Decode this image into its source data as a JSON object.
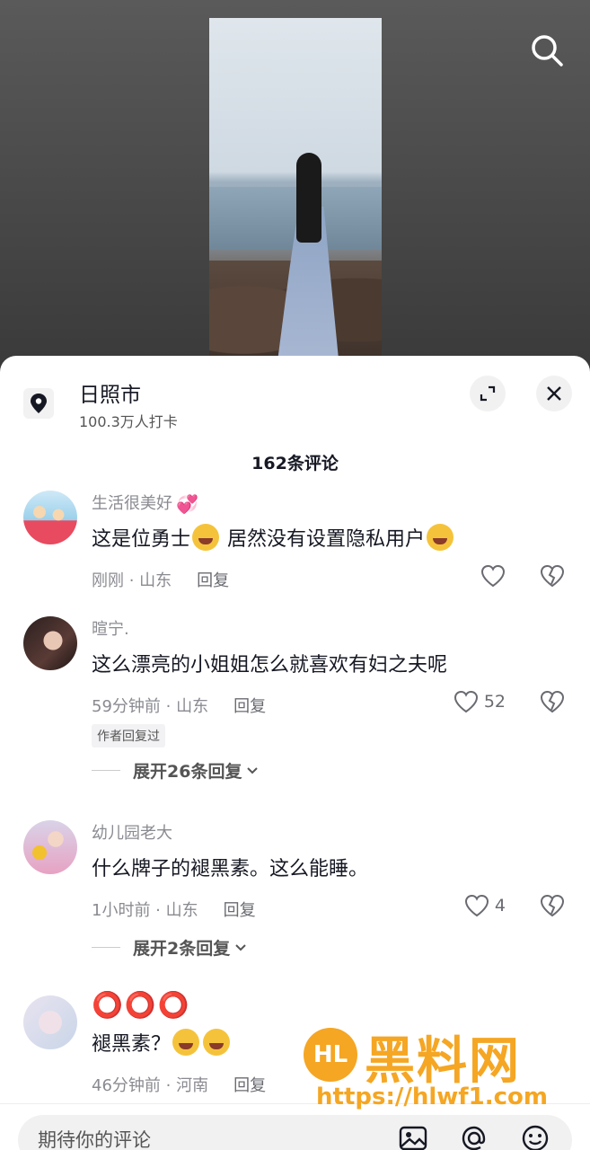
{
  "location": {
    "title": "日照市",
    "checkins": "100.3万人打卡"
  },
  "comments_count": "162条评论",
  "comments": [
    {
      "username": "生活很美好",
      "text_parts": [
        "这是位勇士",
        "居然没有设置隐私用户"
      ],
      "time_region": "刚刚 · 山东",
      "reply_label": "回复",
      "likes": ""
    },
    {
      "username": "暄宁.",
      "text": "这么漂亮的小姐姐怎么就喜欢有妇之夫呢",
      "time_region": "59分钟前 · 山东",
      "reply_label": "回复",
      "likes": "52",
      "author_tag": "作者回复过",
      "expand": "展开26条回复"
    },
    {
      "username": "幼儿园老大",
      "text": "什么牌子的褪黑素。这么能睡。",
      "time_region": "1小时前 · 山东",
      "reply_label": "回复",
      "likes": "4",
      "expand": "展开2条回复"
    },
    {
      "username": "⭕⭕⭕",
      "text": "褪黑素？",
      "time_region": "46分钟前 · 河南",
      "reply_label": "回复",
      "likes": ""
    }
  ],
  "input": {
    "placeholder": "期待你的评论"
  },
  "watermark": {
    "title": "黑料网",
    "url": "https://hlwf1.com",
    "logo_text": "HL"
  },
  "colors": {
    "accent_red": "#e02525",
    "watermark_orange": "#f5a623",
    "text_primary": "#161823",
    "text_secondary": "#8a8b91"
  }
}
